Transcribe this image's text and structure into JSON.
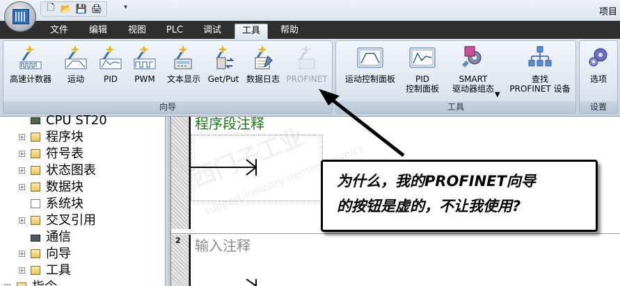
{
  "window": {
    "title_partial": "项目"
  },
  "quick_access": {
    "icons": [
      "new-file-icon",
      "open-folder-icon",
      "save-icon",
      "print-icon"
    ],
    "dropdown_glyph": "▾"
  },
  "menu": {
    "tabs": [
      "文件",
      "编辑",
      "视图",
      "PLC",
      "调试",
      "工具",
      "帮助"
    ],
    "active": "工具"
  },
  "ribbon": {
    "groups": [
      {
        "caption": "向导",
        "buttons": [
          "高速计数器",
          "运动",
          "PID",
          "PWM",
          "文本显示",
          "Get/Put",
          "数据日志",
          "PROFINET"
        ],
        "disabled": [
          "PROFINET"
        ]
      },
      {
        "caption": "工具",
        "buttons": [
          {
            "line1": "运动控制面板",
            "line2": ""
          },
          {
            "line1": "PID",
            "line2": "控制面板"
          },
          {
            "line1": "SMART",
            "line2": "驱动器组态"
          },
          {
            "line1": "查找",
            "line2": "PROFINET 设备"
          }
        ]
      },
      {
        "caption": "设置",
        "buttons": [
          "选项"
        ]
      }
    ]
  },
  "tree": {
    "cpu": "CPU ST20",
    "items": [
      "程序块",
      "符号表",
      "状态图表",
      "数据块",
      "系统块",
      "交叉引用",
      "通信",
      "向导",
      "工具",
      "指令"
    ]
  },
  "editor": {
    "network1_comment": "程序段注释",
    "network2_number": "2",
    "network2_comment": "输入注释"
  },
  "callout": {
    "line1": "为什么，我的PROFINET向导",
    "line2": "的按钮是虚的，不让我使用?"
  },
  "watermark": {
    "text": "西门子工业",
    "url": "support.industry.siemens.com/cs"
  },
  "colors": {
    "ribbon_bg": "#dde5ef",
    "tab_bar": "#2f2f2f",
    "comment_green": "#1a7a1a",
    "comment_gray": "#8c8c8c"
  }
}
